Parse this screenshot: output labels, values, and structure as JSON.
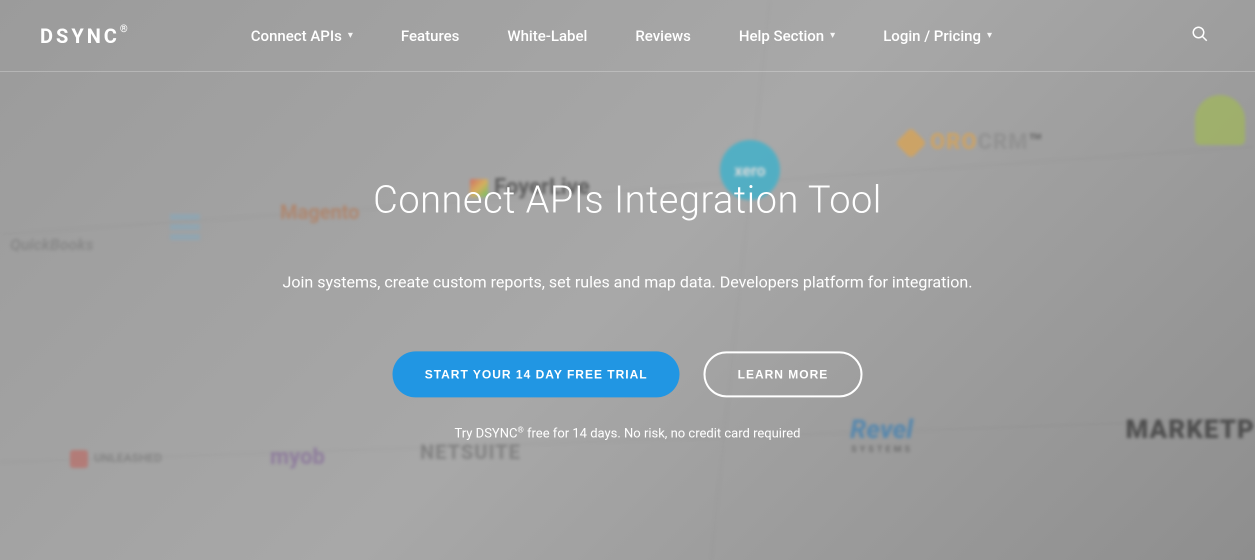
{
  "brand": {
    "name": "DSYNC",
    "mark": "®"
  },
  "nav": {
    "items": [
      {
        "label": "Connect APIs",
        "dropdown": true
      },
      {
        "label": "Features",
        "dropdown": false
      },
      {
        "label": "White-Label",
        "dropdown": false
      },
      {
        "label": "Reviews",
        "dropdown": false
      },
      {
        "label": "Help Section",
        "dropdown": true
      },
      {
        "label": "Login / Pricing",
        "dropdown": true
      }
    ]
  },
  "hero": {
    "title": "Connect APIs Integration Tool",
    "subtitle": "Join systems, create custom reports, set rules and map data. Developers platform for integration.",
    "cta_primary": "START YOUR 14 DAY FREE TRIAL",
    "cta_secondary": "LEARN MORE",
    "fineprint_pre": "Try DSYNC",
    "fineprint_mark": "®",
    "fineprint_post": " free for 14 days. No risk, no credit card required"
  },
  "bg_logos": {
    "magento": "Magento",
    "foyer": "FoyerLive",
    "xero": "xero",
    "orocrm_a": "ORO",
    "orocrm_b": "CRM",
    "revel": "Revel",
    "revel_sub": "SYSTEMS",
    "marketp": "MARKETP",
    "myob": "myob",
    "unleashed": "UNLEASHED",
    "netsuite": "NETSUITE",
    "quickbooks": "QuickBooks"
  }
}
